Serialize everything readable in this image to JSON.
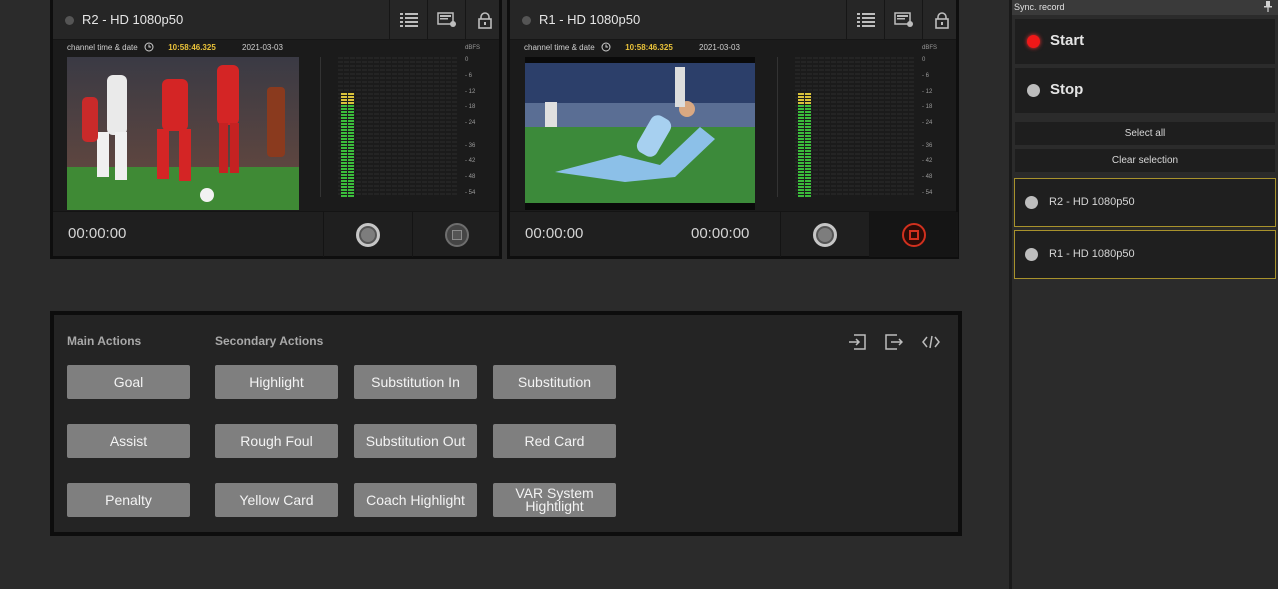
{
  "channels": [
    {
      "title": "R2 - HD 1080p50",
      "info_label": "channel  time & date",
      "time": "10:58:46.325",
      "date": "2021-03-03",
      "timecode_left": "00:00:00",
      "timecode_right": "",
      "scale": [
        "dBFS",
        "0",
        "- 6",
        "- 12",
        "- 18",
        "- 24",
        "- 36",
        "- 42",
        "- 48",
        "- 54"
      ]
    },
    {
      "title": "R1 - HD 1080p50",
      "info_label": "channel  time & date",
      "time": "10:58:46.325",
      "date": "2021-03-03",
      "timecode_left": "00:00:00",
      "timecode_right": "00:00:00",
      "scale": [
        "dBFS",
        "0",
        "- 6",
        "- 12",
        "- 18",
        "- 24",
        "- 36",
        "- 42",
        "- 48",
        "- 54"
      ]
    }
  ],
  "actions": {
    "main_title": "Main Actions",
    "secondary_title": "Secondary Actions",
    "main": [
      "Goal",
      "Assist",
      "Penalty"
    ],
    "secondary": [
      [
        "Highlight",
        "Substitution In",
        "Substitution"
      ],
      [
        "Rough Foul",
        "Substitution Out",
        "Red Card"
      ],
      [
        "Yellow Card",
        "Coach Highlight",
        "VAR System Hightlight"
      ]
    ]
  },
  "sync": {
    "header": "Sync. record",
    "start": "Start",
    "stop": "Stop",
    "select_all": "Select all",
    "clear_selection": "Clear selection",
    "channels": [
      "R2 - HD 1080p50",
      "R1 - HD 1080p50"
    ]
  },
  "colors": {
    "accent_gold": "#a8922c",
    "time_yellow": "#e9c23a",
    "record_red": "#d1301e"
  }
}
